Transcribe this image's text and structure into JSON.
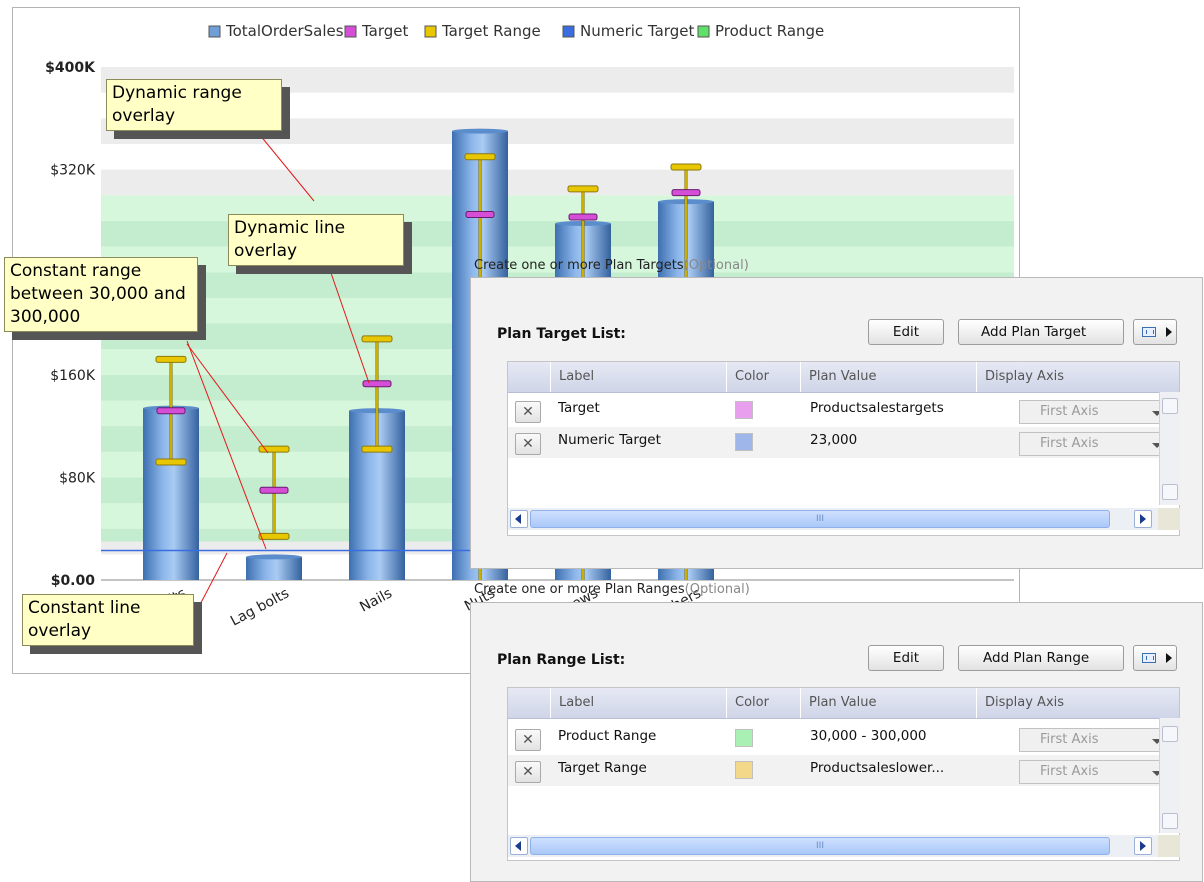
{
  "chart_data": {
    "type": "bar",
    "categories": [
      "Hex bolts",
      "Lag bolts",
      "Nails",
      "Nuts",
      "Screws",
      "Washers"
    ],
    "y_ticks": [
      "$0.00",
      "$80K",
      "$160K",
      "$240K",
      "$320K",
      "$400K"
    ],
    "ylim": [
      0,
      400000
    ],
    "grid": true,
    "legend_position": "top",
    "series": [
      {
        "name": "TotalOrderSales",
        "color": "#6f9fd6",
        "values": [
          134000,
          18000,
          132000,
          350000,
          278000,
          295000
        ]
      },
      {
        "name": "Target",
        "color": "#d44fd6",
        "values": [
          132000,
          70000,
          153000,
          285000,
          283000,
          302000
        ]
      },
      {
        "name": "Target Range",
        "color": "#e8c600",
        "lows": [
          92000,
          34000,
          102000,
          0,
          0,
          0
        ],
        "highs": [
          172000,
          102000,
          188000,
          330000,
          305000,
          322000
        ]
      },
      {
        "name": "Numeric Target",
        "color": "#3a6de0",
        "value": 23000
      },
      {
        "name": "Product Range",
        "color": "#5ee06a",
        "low": 30000,
        "high": 300000
      }
    ],
    "annotations": [
      {
        "text": "Dynamic range overlay"
      },
      {
        "text": "Dynamic line overlay"
      },
      {
        "text": "Constant range between 30,000 and 300,000"
      },
      {
        "text": "Constant line overlay"
      }
    ]
  },
  "targets_panel": {
    "caption": "Create one or more Plan Targets",
    "optional": "(Optional)",
    "title": "Plan Target List:",
    "edit_label": "Edit",
    "add_label": "Add Plan Target",
    "columns": [
      "Label",
      "Color",
      "Plan Value",
      "Display Axis"
    ],
    "rows": [
      {
        "label": "Target",
        "color": "#e8a0ee",
        "value": "Productsalestargets",
        "axis": "First Axis"
      },
      {
        "label": "Numeric Target",
        "color": "#9fb6ea",
        "value": "23,000",
        "axis": "First Axis"
      }
    ],
    "scroll_thumb_label": "III"
  },
  "ranges_panel": {
    "caption": "Create one or more Plan Ranges",
    "optional": "(Optional)",
    "title": "Plan Range List:",
    "edit_label": "Edit",
    "add_label": "Add Plan Range",
    "columns": [
      "Label",
      "Color",
      "Plan Value",
      "Display Axis"
    ],
    "rows": [
      {
        "label": "Product Range",
        "color": "#a9f0b4",
        "value": "30,000 - 300,000",
        "axis": "First Axis"
      },
      {
        "label": "Target Range",
        "color": "#f3d88a",
        "value": "Productsaleslower...",
        "axis": "First Axis"
      }
    ],
    "scroll_thumb_label": "III"
  }
}
